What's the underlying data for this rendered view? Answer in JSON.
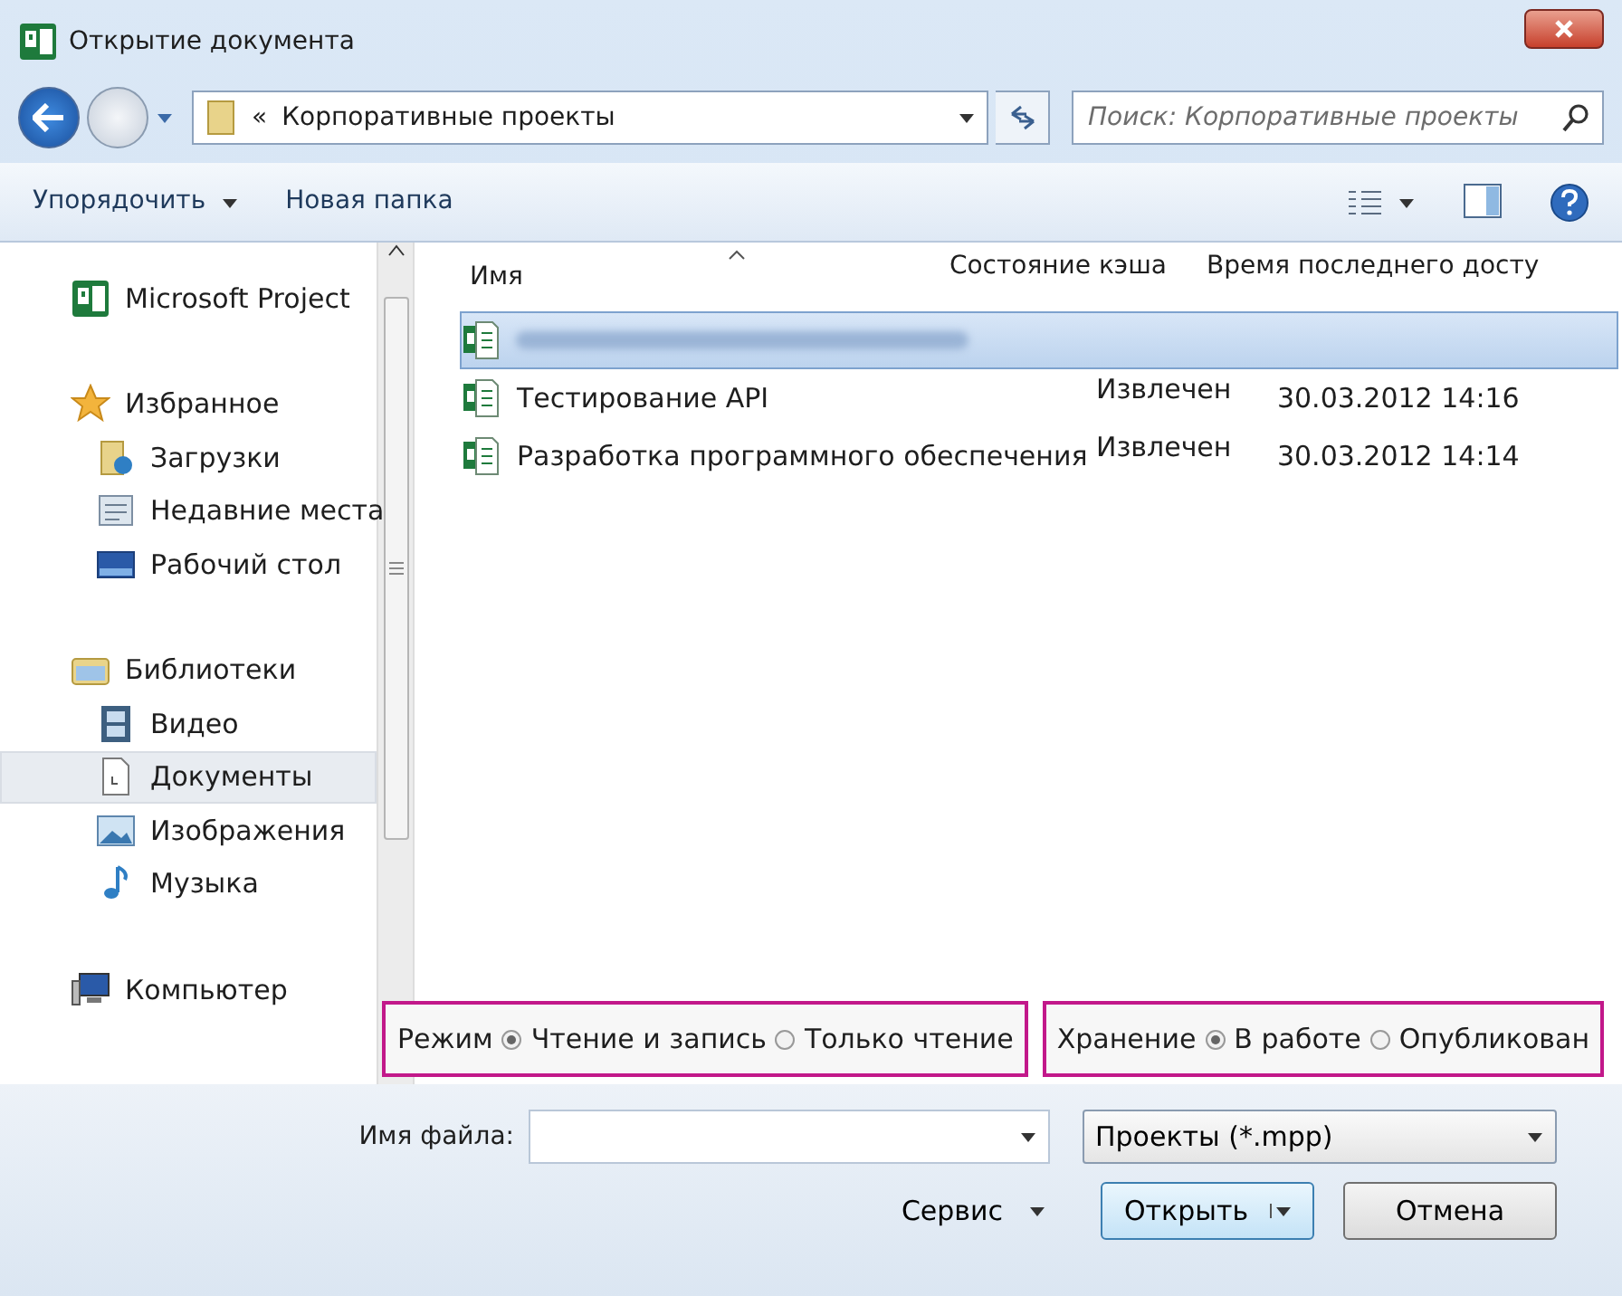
{
  "window": {
    "title": "Открытие документа"
  },
  "address": {
    "prefix": "«",
    "path": "Корпоративные проекты"
  },
  "search": {
    "placeholder": "Поиск: Корпоративные проекты"
  },
  "toolbar": {
    "organize": "Упорядочить",
    "new_folder": "Новая папка"
  },
  "sidebar": [
    {
      "label": "Microsoft Project",
      "kind": "project",
      "selected": false
    },
    {
      "label": "Избранное",
      "kind": "star",
      "selected": false,
      "children": [
        {
          "label": "Загрузки",
          "kind": "download",
          "selected": false
        },
        {
          "label": "Недавние места",
          "kind": "recent",
          "selected": false
        },
        {
          "label": "Рабочий стол",
          "kind": "desktop",
          "selected": false
        }
      ]
    },
    {
      "label": "Библиотеки",
      "kind": "library",
      "selected": false,
      "children": [
        {
          "label": "Видео",
          "kind": "video",
          "selected": false
        },
        {
          "label": "Документы",
          "kind": "document",
          "selected": true
        },
        {
          "label": "Изображения",
          "kind": "pictures",
          "selected": false
        },
        {
          "label": "Музыка",
          "kind": "music",
          "selected": false
        }
      ]
    },
    {
      "label": "Компьютер",
      "kind": "computer",
      "selected": false
    }
  ],
  "columns": [
    {
      "label": "Имя",
      "sorted": true
    },
    {
      "label": "Состояние кэша",
      "sorted": false
    },
    {
      "label": "Время последнего досту",
      "sorted": false
    }
  ],
  "files": [
    {
      "kind": "blurred",
      "selected": true
    },
    {
      "kind": "file",
      "name": "Тестирование API",
      "cache": "Извлечен",
      "time": "30.03.2012 14:16",
      "selected": false
    },
    {
      "kind": "file",
      "name": "Разработка программного обеспечения",
      "cache": "Извлечен",
      "time": "30.03.2012 14:14",
      "selected": false
    }
  ],
  "modes": [
    {
      "label": "Режим",
      "options": [
        {
          "label": "Чтение и запись",
          "selected": true
        },
        {
          "label": "Только чтение",
          "selected": false
        }
      ]
    },
    {
      "label": "Хранение",
      "options": [
        {
          "label": "В работе",
          "selected": true
        },
        {
          "label": "Опубликован",
          "selected": false
        }
      ]
    }
  ],
  "filename": {
    "label": "Имя файла:"
  },
  "filetype": "Проекты (*.mpp)",
  "buttons": {
    "service": "Сервис",
    "open": "Открыть",
    "cancel": "Отмена"
  }
}
